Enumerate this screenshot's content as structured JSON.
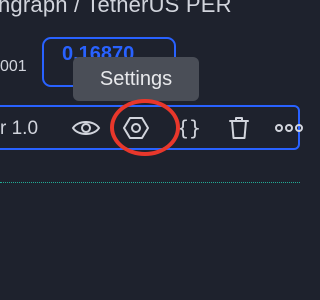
{
  "window": {
    "title": "hgraph / TetherUS PER"
  },
  "settings_row": {
    "step_label": "001",
    "value": "0.16870"
  },
  "tooltip": {
    "text": "Settings"
  },
  "indicator_toolbar": {
    "label": "r 1.0",
    "buttons": [
      {
        "name": "visibility",
        "icon": "eye-icon"
      },
      {
        "name": "settings",
        "icon": "gear-icon"
      },
      {
        "name": "source-code",
        "icon": "braces-icon",
        "glyph": "{}"
      },
      {
        "name": "remove",
        "icon": "trash-icon"
      },
      {
        "name": "more",
        "icon": "more-icon"
      }
    ]
  },
  "colors": {
    "background": "#1e222d",
    "accent": "#2962ff",
    "highlight": "#e8372b",
    "tooltip_bg": "#4a4e57",
    "plot_line": "#22ab94"
  }
}
